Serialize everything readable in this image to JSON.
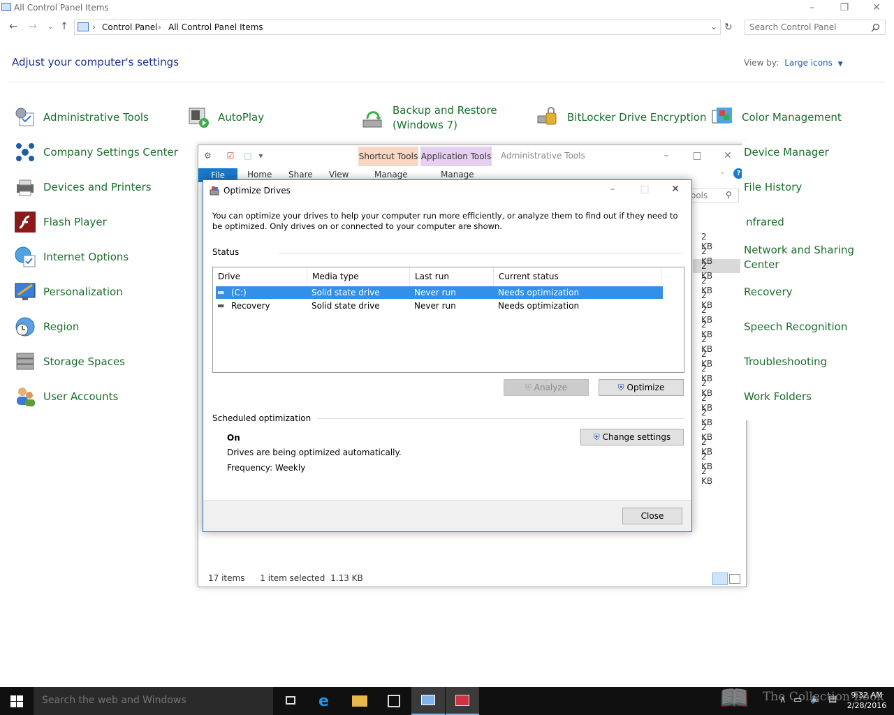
{
  "control_panel": {
    "window_title": "All Control Panel Items",
    "breadcrumbs": [
      "Control Panel",
      "All Control Panel Items"
    ],
    "search_placeholder": "Search Control Panel",
    "heading": "Adjust your computer's settings",
    "view_by_label": "View by:",
    "view_by_value": "Large icons",
    "items_col1": [
      "Administrative Tools",
      "Company Settings Center",
      "Devices and Printers",
      "Flash Player",
      "Internet Options",
      "Personalization",
      "Region",
      "Storage Spaces",
      "User Accounts"
    ],
    "item_col2_top": "AutoPlay",
    "item_col3_top": "Backup and Restore (Windows 7)",
    "item_col4_top": "BitLocker Drive Encryption",
    "items_col5": [
      "Color Management",
      "Device Manager",
      "File History",
      "Infrared",
      "Network and Sharing Center",
      "Recovery",
      "Speech Recognition",
      "Troubleshooting",
      "Work Folders"
    ],
    "items_col5_visible": [
      "Color Management",
      "Device Manager",
      "File History",
      "nfrared",
      "Network and Sharing Center",
      "Recovery",
      "Speech Recognition",
      "Troubleshooting",
      "Work Folders"
    ]
  },
  "explorer": {
    "shortcut_tools": "Shortcut Tools",
    "application_tools": "Application Tools",
    "title": "Administrative Tools",
    "tabs": {
      "file": "File",
      "home": "Home",
      "share": "Share",
      "view": "View",
      "manage1": "Manage",
      "manage2": "Manage"
    },
    "search_partial": "ools",
    "sizes": [
      "2 KB",
      "2 KB",
      "2 KB",
      "2 KB",
      "2 KB",
      "2 KB",
      "2 KB",
      "2 KB",
      "2 KB",
      "2 KB",
      "2 KB",
      "2 KB",
      "2 KB",
      "2 KB",
      "2 KB",
      "2 KB",
      "2 KB"
    ],
    "status_items": "17 items",
    "status_selected": "1 item selected",
    "status_size": "1.13 KB"
  },
  "dialog": {
    "title": "Optimize Drives",
    "description": "You can optimize your drives to help your computer run more efficiently, or analyze them to find out if they need to be optimized. Only drives on or connected to your computer are shown.",
    "status_label": "Status",
    "columns": [
      "Drive",
      "Media type",
      "Last run",
      "Current status"
    ],
    "drives": [
      {
        "drive": "(C:)",
        "media": "Solid state drive",
        "last_run": "Never run",
        "status": "Needs optimization",
        "selected": true
      },
      {
        "drive": "Recovery",
        "media": "Solid state drive",
        "last_run": "Never run",
        "status": "Needs optimization",
        "selected": false
      }
    ],
    "analyze_label": "Analyze",
    "optimize_label": "Optimize",
    "scheduled_label": "Scheduled optimization",
    "scheduled_state": "On",
    "scheduled_desc": "Drives are being optimized automatically.",
    "frequency": "Frequency: Weekly",
    "change_settings_label": "Change settings",
    "close_label": "Close"
  },
  "taskbar": {
    "search_placeholder": "Search the web and Windows",
    "time": "9:32 AM",
    "date": "2/28/2016"
  },
  "watermark": "The Collection Book",
  "colors": {
    "accent": "#3390e8",
    "link_green": "#1b6e2c",
    "heading_blue": "#1e3287",
    "file_tab": "#1979ca"
  }
}
